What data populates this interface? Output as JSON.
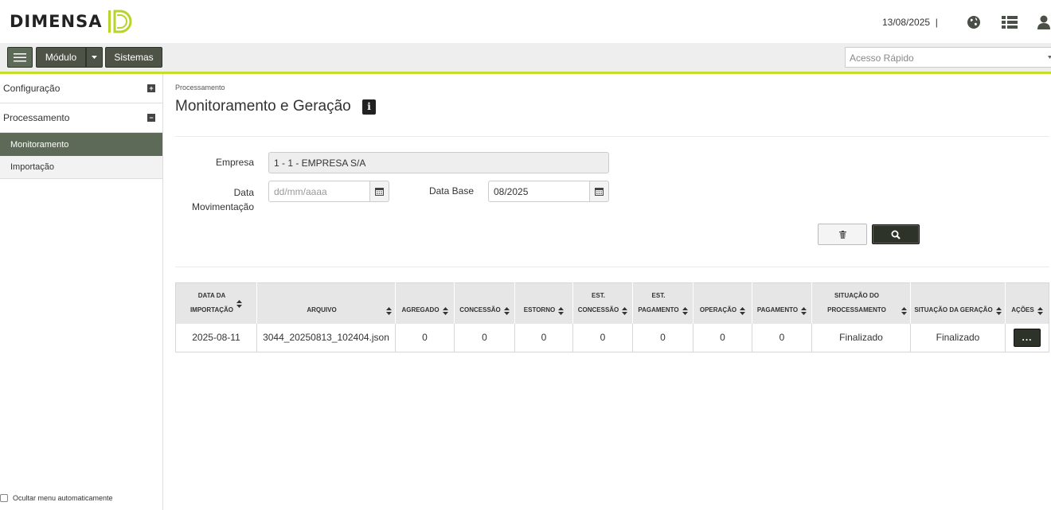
{
  "header": {
    "logo_text": "DIMENSA",
    "date": "13/08/2025",
    "separator": "|",
    "icons": [
      "globe-icon",
      "list-icon",
      "user-icon"
    ]
  },
  "toolbar": {
    "modulo_label": "Módulo",
    "sistemas_label": "Sistemas",
    "quick_access_placeholder": "Acesso Rápido",
    "accent_color": "#c4dd2e"
  },
  "sidebar": {
    "items": [
      {
        "label": "Configuração",
        "state": "collapsed",
        "toggle": "+"
      },
      {
        "label": "Processamento",
        "state": "expanded",
        "toggle": "−"
      }
    ],
    "subitems": [
      {
        "label": "Monitoramento",
        "active": true
      },
      {
        "label": "Importação",
        "active": false
      }
    ],
    "auto_hide_label": "Ocultar menu automaticamente"
  },
  "main": {
    "breadcrumb": "Processamento",
    "title": "Monitoramento e Geração",
    "form": {
      "empresa_label": "Empresa",
      "empresa_value": "1 - 1 - EMPRESA S/A",
      "data_mov_label_1": "Data",
      "data_mov_label_2": "Movimentação",
      "data_mov_placeholder": "dd/mm/aaaa",
      "data_base_label": "Data Base",
      "data_base_value": "08/2025"
    },
    "table": {
      "headers": [
        [
          "DATA DA",
          "IMPORTAÇÃO"
        ],
        [
          "ARQUIVO"
        ],
        [
          "AGREGADO"
        ],
        [
          "CONCESSÃO"
        ],
        [
          "ESTORNO"
        ],
        [
          "EST.",
          "CONCESSÃO"
        ],
        [
          "EST.",
          "PAGAMENTO"
        ],
        [
          "OPERAÇÃO"
        ],
        [
          "PAGAMENTO"
        ],
        [
          "SITUAÇÃO DO",
          "PROCESSAMENTO"
        ],
        [
          "SITUAÇÃO DA GERAÇÃO"
        ],
        [
          "AÇÕES"
        ]
      ],
      "rows": [
        {
          "data_importacao": "2025-08-11",
          "arquivo": "3044_20250813_102404.json",
          "agregado": "0",
          "concessao": "0",
          "estorno": "0",
          "est_concessao": "0",
          "est_pagamento": "0",
          "operacao": "0",
          "pagamento": "0",
          "situacao_processamento": "Finalizado",
          "situacao_geracao": "Finalizado",
          "acoes": "..."
        }
      ]
    }
  }
}
